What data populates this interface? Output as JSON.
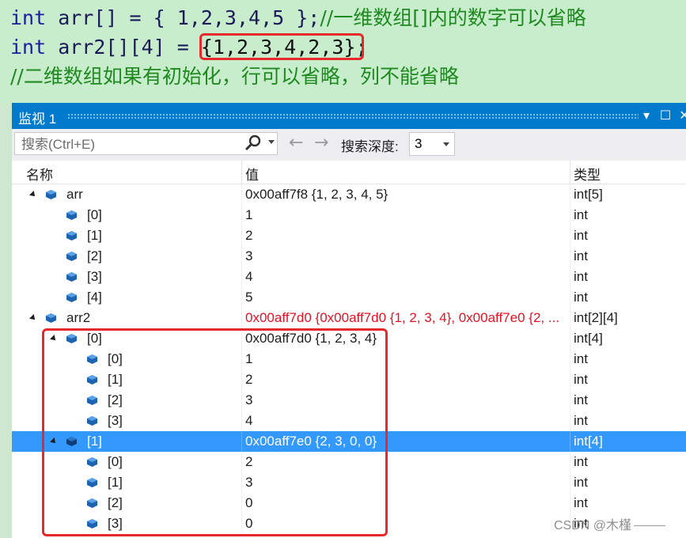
{
  "code": {
    "line1": {
      "kw": "int",
      "rest": " arr[] = { 1,2,3,4,5 };",
      "comment": "//一维数组[]内的数字可以省略"
    },
    "line2": {
      "kw": "int",
      "pre": " arr2[][4] = ",
      "highlight": "{1,2,3,4,2,3}",
      "post": ";"
    },
    "line3": {
      "comment": "//二维数组如果有初始化，行可以省略，列不能省略"
    }
  },
  "window": {
    "title": "监视 1",
    "search_placeholder": "搜索(Ctrl+E)",
    "depth_label": "搜索深度:",
    "depth_value": "3"
  },
  "columns": {
    "name": "名称",
    "value": "值",
    "type": "类型"
  },
  "rows": [
    {
      "name": "arr",
      "value": "0x00aff7f8 {1, 2, 3, 4, 5}",
      "type": "int[5]"
    },
    {
      "name": "[0]",
      "value": "1",
      "type": "int"
    },
    {
      "name": "[1]",
      "value": "2",
      "type": "int"
    },
    {
      "name": "[2]",
      "value": "3",
      "type": "int"
    },
    {
      "name": "[3]",
      "value": "4",
      "type": "int"
    },
    {
      "name": "[4]",
      "value": "5",
      "type": "int"
    },
    {
      "name": "arr2",
      "value": "0x00aff7d0 {0x00aff7d0 {1, 2, 3, 4}, 0x00aff7e0 {2, ...",
      "type": "int[2][4]"
    },
    {
      "name": "[0]",
      "value": "0x00aff7d0 {1, 2, 3, 4}",
      "type": "int[4]"
    },
    {
      "name": "[0]",
      "value": "1",
      "type": "int"
    },
    {
      "name": "[1]",
      "value": "2",
      "type": "int"
    },
    {
      "name": "[2]",
      "value": "3",
      "type": "int"
    },
    {
      "name": "[3]",
      "value": "4",
      "type": "int"
    },
    {
      "name": "[1]",
      "value": "0x00aff7e0 {2, 3, 0, 0}",
      "type": "int[4]"
    },
    {
      "name": "[0]",
      "value": "2",
      "type": "int"
    },
    {
      "name": "[1]",
      "value": "3",
      "type": "int"
    },
    {
      "name": "[2]",
      "value": "0",
      "type": "int"
    },
    {
      "name": "[3]",
      "value": "0",
      "type": "int"
    }
  ],
  "watermark": "CSDN @木槿",
  "colors": {
    "accent": "#007acc",
    "selection": "#3399ff",
    "changed_value": "#e81123",
    "annotation": "#e8282b"
  }
}
